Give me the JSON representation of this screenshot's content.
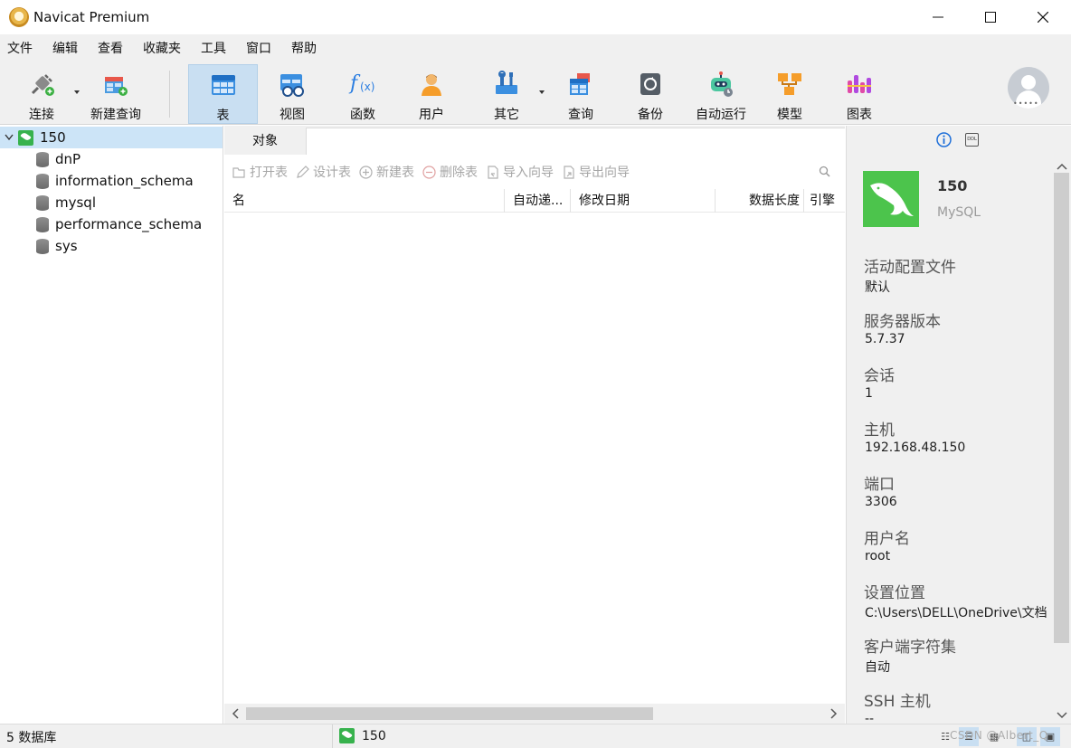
{
  "window": {
    "title": "Navicat Premium"
  },
  "menu": [
    "文件",
    "编辑",
    "查看",
    "收藏夹",
    "工具",
    "窗口",
    "帮助"
  ],
  "toolbar": {
    "connect": "连接",
    "new_query": "新建查询",
    "table": "表",
    "view": "视图",
    "function": "函数",
    "user": "用户",
    "other": "其它",
    "query": "查询",
    "backup": "备份",
    "autorun": "自动运行",
    "model": "模型",
    "chart": "图表"
  },
  "tree": {
    "connection": "150",
    "databases": [
      "dnP",
      "information_schema",
      "mysql",
      "performance_schema",
      "sys"
    ]
  },
  "tabs": {
    "objects": "对象"
  },
  "objbar": {
    "open_table": "打开表",
    "design_table": "设计表",
    "new_table": "新建表",
    "delete_table": "删除表",
    "import_wizard": "导入向导",
    "export_wizard": "导出向导"
  },
  "columns": [
    "名",
    "自动递...",
    "修改日期",
    "数据长度",
    "引擎"
  ],
  "info": {
    "name": "150",
    "type": "MySQL",
    "fields": [
      {
        "label": "活动配置文件",
        "value": "默认"
      },
      {
        "label": "服务器版本",
        "value": "5.7.37"
      },
      {
        "label": "会话",
        "value": "1"
      },
      {
        "label": "主机",
        "value": "192.168.48.150"
      },
      {
        "label": "端口",
        "value": "3306"
      },
      {
        "label": "用户名",
        "value": "root"
      },
      {
        "label": "设置位置",
        "value": "C:\\Users\\DELL\\OneDrive\\文档"
      },
      {
        "label": "客户端字符集",
        "value": "自动"
      },
      {
        "label": "SSH 主机",
        "value": "--"
      }
    ]
  },
  "status": {
    "db_count": "5 数据库",
    "connection": "150",
    "watermark": "CSDN @Albert_Q"
  },
  "colors": {
    "active_toolbar": "#c9dff2",
    "tree_selected": "#cce4f7",
    "mysql_green": "#4cc44c"
  }
}
